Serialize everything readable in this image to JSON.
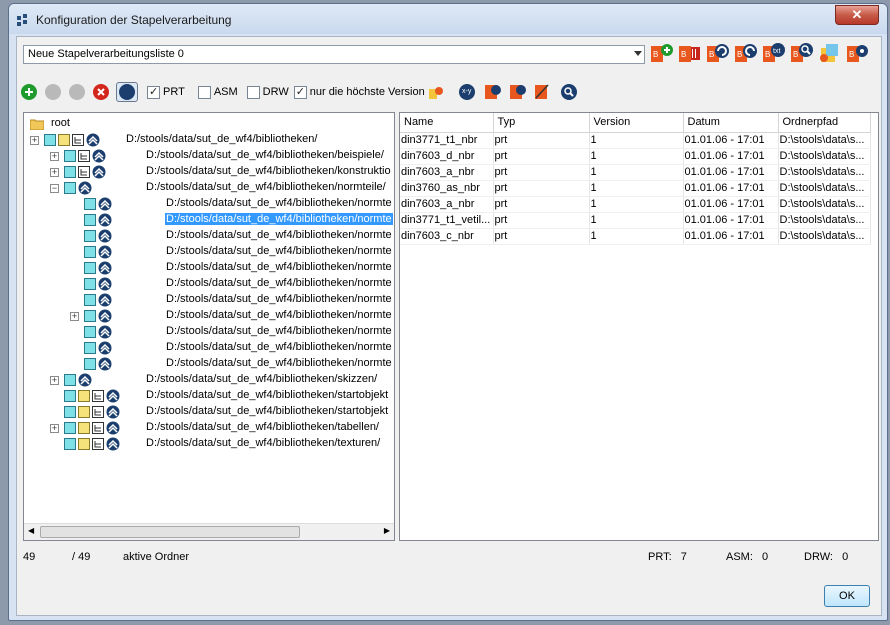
{
  "window": {
    "title": "Konfiguration der Stapelverarbeitung",
    "close_label": "✕"
  },
  "combo": {
    "value": "Neue Stapelverarbeitungsliste 0"
  },
  "toolbar": {
    "prt_label": "PRT",
    "prt_checked": true,
    "asm_label": "ASM",
    "asm_checked": false,
    "drw_label": "DRW",
    "drw_checked": false,
    "latest_label": "nur die höchste Version",
    "latest_checked": true
  },
  "tree": {
    "root_label": "root",
    "nodes": [
      "D:/stools/data/sut_de_wf4/bibliotheken/",
      "D:/stools/data/sut_de_wf4/bibliotheken/beispiele/",
      "D:/stools/data/sut_de_wf4/bibliotheken/konstruktio",
      "D:/stools/data/sut_de_wf4/bibliotheken/normteile/",
      "D:/stools/data/sut_de_wf4/bibliotheken/normte",
      "D:/stools/data/sut_de_wf4/bibliotheken/normte",
      "D:/stools/data/sut_de_wf4/bibliotheken/normte",
      "D:/stools/data/sut_de_wf4/bibliotheken/normte",
      "D:/stools/data/sut_de_wf4/bibliotheken/normte",
      "D:/stools/data/sut_de_wf4/bibliotheken/normte",
      "D:/stools/data/sut_de_wf4/bibliotheken/normte",
      "D:/stools/data/sut_de_wf4/bibliotheken/normte",
      "D:/stools/data/sut_de_wf4/bibliotheken/normte",
      "D:/stools/data/sut_de_wf4/bibliotheken/normte",
      "D:/stools/data/sut_de_wf4/bibliotheken/normte",
      "D:/stools/data/sut_de_wf4/bibliotheken/skizzen/",
      "D:/stools/data/sut_de_wf4/bibliotheken/startobjekt",
      "D:/stools/data/sut_de_wf4/bibliotheken/startobjekt",
      "D:/stools/data/sut_de_wf4/bibliotheken/tabellen/",
      "D:/stools/data/sut_de_wf4/bibliotheken/texturen/"
    ]
  },
  "table": {
    "headers": [
      "Name",
      "Typ",
      "Version",
      "Datum",
      "Ordnerpfad"
    ],
    "rows": [
      [
        "din3771_t1_nbr",
        "prt",
        "1",
        "01.01.06 - 17:01",
        "D:\\stools\\data\\s..."
      ],
      [
        "din7603_d_nbr",
        "prt",
        "1",
        "01.01.06 - 17:01",
        "D:\\stools\\data\\s..."
      ],
      [
        "din7603_a_nbr",
        "prt",
        "1",
        "01.01.06 - 17:01",
        "D:\\stools\\data\\s..."
      ],
      [
        "din3760_as_nbr",
        "prt",
        "1",
        "01.01.06 - 17:01",
        "D:\\stools\\data\\s..."
      ],
      [
        "din7603_a_nbr",
        "prt",
        "1",
        "01.01.06 - 17:01",
        "D:\\stools\\data\\s..."
      ],
      [
        "din3771_t1_vetil...",
        "prt",
        "1",
        "01.01.06 - 17:01",
        "D:\\stools\\data\\s..."
      ],
      [
        "din7603_c_nbr",
        "prt",
        "1",
        "01.01.06 - 17:01",
        "D:\\stools\\data\\s..."
      ]
    ]
  },
  "status": {
    "count_a": "49",
    "count_b": "/ 49",
    "active_label": "aktive Ordner",
    "prt": "PRT:   7",
    "asm": "ASM:   0",
    "drw": "DRW:   0"
  },
  "ok_label": "OK"
}
